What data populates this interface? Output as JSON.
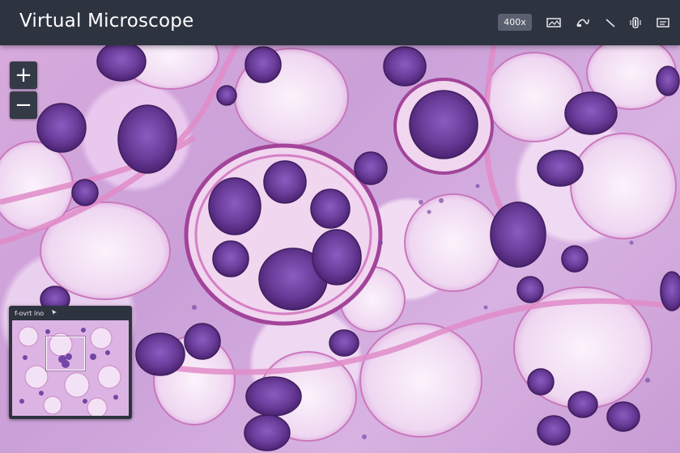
{
  "app": {
    "title": "Virtual Microscope"
  },
  "toolbar": {
    "zoom_level": "400x",
    "icons": [
      "image-compare-icon",
      "annotation-icon",
      "ruler-icon",
      "brightness-icon",
      "layers-icon"
    ]
  },
  "controls": {
    "zoom_in_label": "+",
    "zoom_out_label": "−"
  },
  "minimap": {
    "title": "f-ovrt lno"
  },
  "colors": {
    "toolbar_bg": "#2e3340",
    "stain_nuclei": "#6a3d9a",
    "stain_cytoplasm": "#f3e1f4",
    "stain_stroma": "#d98cc7"
  }
}
